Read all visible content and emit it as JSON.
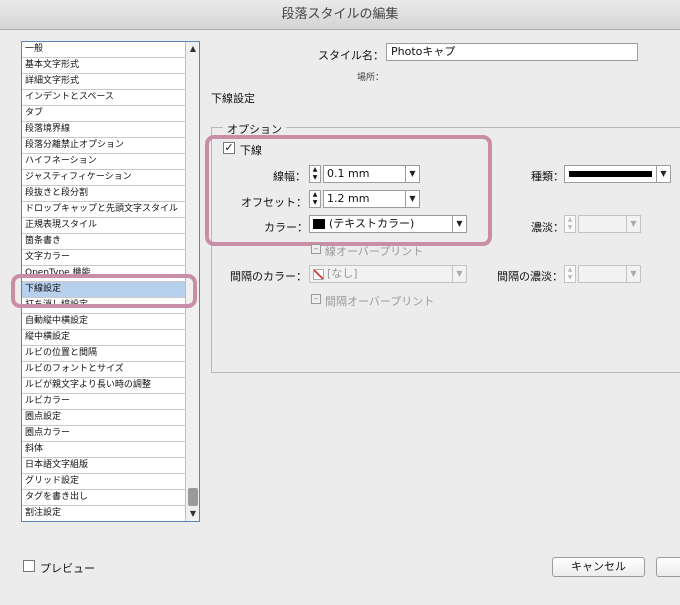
{
  "window": {
    "title": "段落スタイルの編集"
  },
  "categories": [
    "一般",
    "基本文字形式",
    "詳細文字形式",
    "インデントとスペース",
    "タブ",
    "段落境界線",
    "段落分離禁止オプション",
    "ハイフネーション",
    "ジャスティフィケーション",
    "段抜きと段分割",
    "ドロップキャップと先頭文字スタイル",
    "正規表現スタイル",
    "箇条書き",
    "文字カラー",
    "OpenType 機能",
    "下線設定",
    "打ち消し線設定",
    "自動縦中横設定",
    "縦中横設定",
    "ルビの位置と間隔",
    "ルビのフォントとサイズ",
    "ルビが親文字より長い時の調整",
    "ルビカラー",
    "圏点設定",
    "圏点カラー",
    "斜体",
    "日本語文字組版",
    "グリッド設定",
    "タグを書き出し",
    "割注設定"
  ],
  "selected_category": "下線設定",
  "style_name": {
    "label": "スタイル名：",
    "value": "Photoキャプ"
  },
  "location": {
    "label": "場所："
  },
  "section_title": "下線設定",
  "options": {
    "legend": "オプション",
    "underline": {
      "label": "下線",
      "checked": "✓"
    },
    "weight": {
      "label": "線幅：",
      "value": "0.1 mm"
    },
    "offset": {
      "label": "オフセット：",
      "value": "1.2 mm"
    },
    "color": {
      "label": "カラー：",
      "value": "(テキストカラー)"
    },
    "type": {
      "label": "種類："
    },
    "tint": {
      "label": "濃淡：",
      "value": ""
    },
    "overprint_stroke": {
      "label": "線オーバープリント"
    },
    "gap_color": {
      "label": "間隔のカラー：",
      "value": "[なし]"
    },
    "gap_tint": {
      "label": "間隔の濃淡：",
      "value": ""
    },
    "overprint_gap": {
      "label": "間隔オーバープリント"
    }
  },
  "preview": {
    "label": "プレビュー"
  },
  "buttons": {
    "cancel": "キャンセル",
    "ok": ""
  },
  "icons": {
    "arrow_down": "▼",
    "arrow_up": "▲",
    "step_up": "▲",
    "step_down": "▼"
  }
}
